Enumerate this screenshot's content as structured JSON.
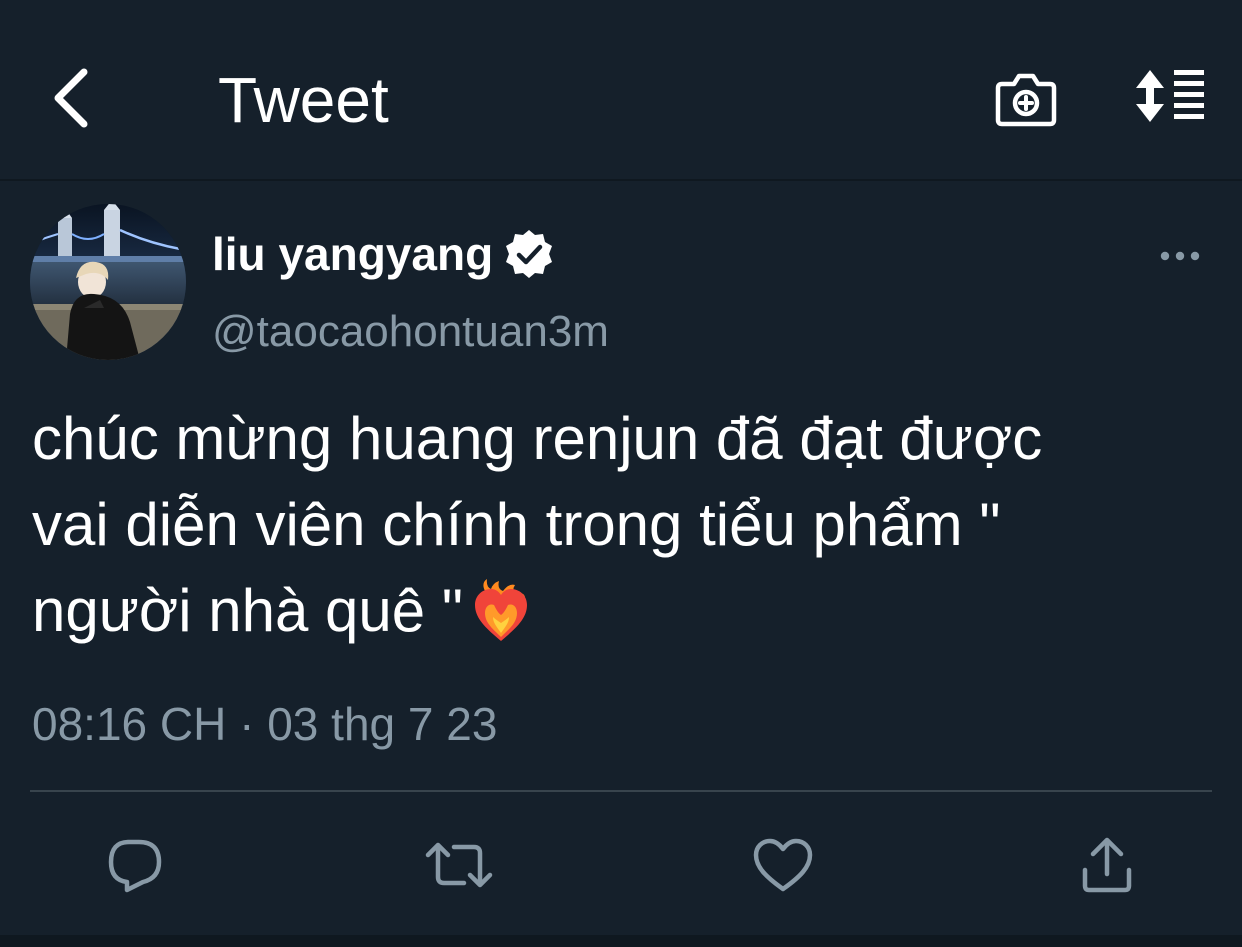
{
  "header": {
    "title": "Tweet",
    "back_icon": "chevron-left-icon",
    "camera_icon": "camera-plus-icon",
    "sort_icon": "sort-lines-icon"
  },
  "tweet": {
    "author": {
      "display_name": "liu yangyang",
      "handle": "@taocaohontuan3m",
      "verified": true
    },
    "text_lines": [
      "chúc mừng huang renjun đã đạt được",
      "vai diễn viên chính trong tiểu phẩm \"",
      "người nhà quê \""
    ],
    "emoji": "heart-on-fire",
    "timestamp": "08:16 CH · 03 thg 7 23"
  },
  "actions": {
    "reply_icon": "reply-icon",
    "retweet_icon": "retweet-icon",
    "like_icon": "heart-icon",
    "share_icon": "share-icon"
  },
  "colors": {
    "background": "#15202b",
    "secondary_text": "#8899a6",
    "divider": "#38444d",
    "primary_text": "#ffffff"
  }
}
